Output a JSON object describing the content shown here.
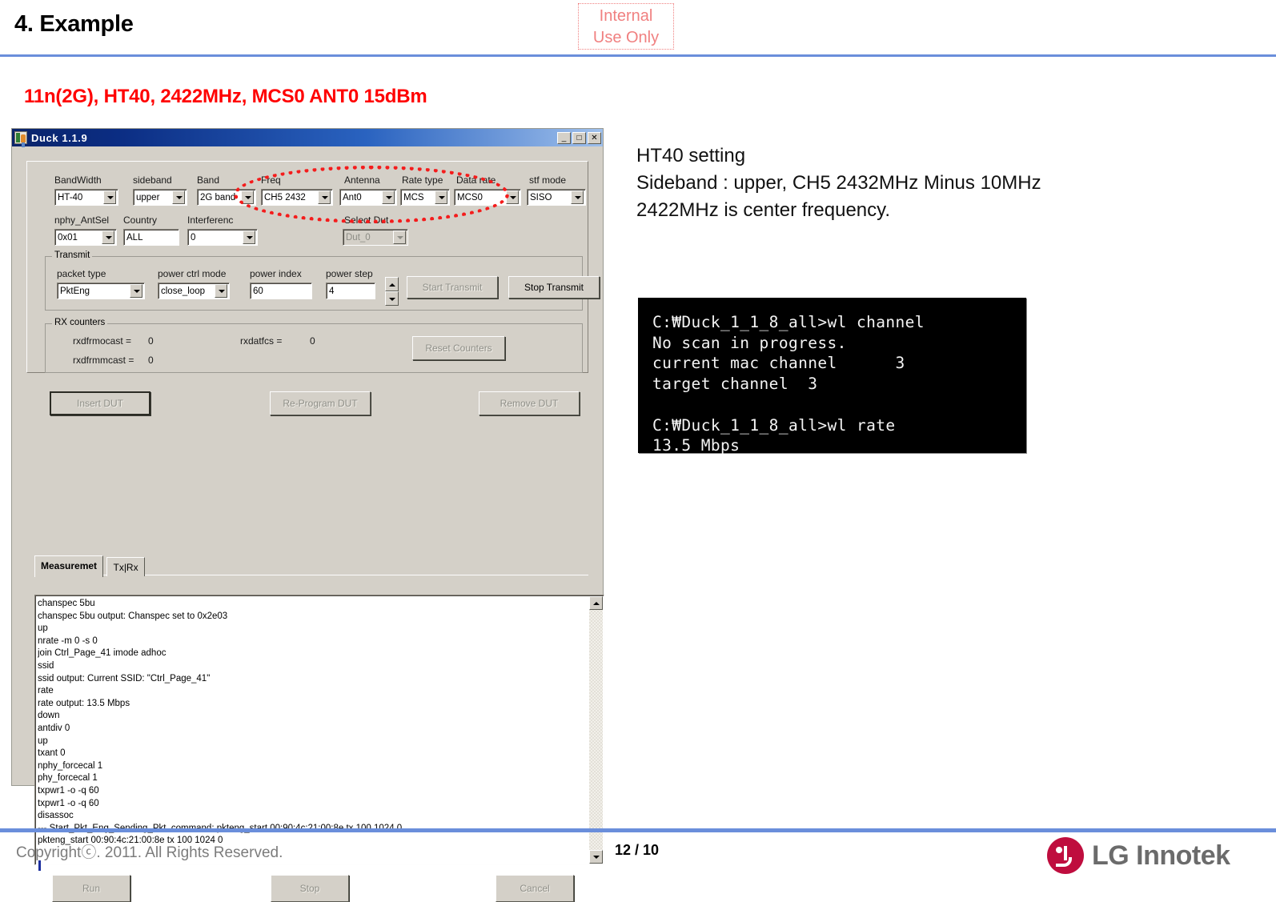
{
  "slide": {
    "title": "4. Example",
    "stamp_line1": "Internal",
    "stamp_line2": "Use Only",
    "caption": "11n(2G), HT40, 2422MHz, MCS0 ANT0 15dBm",
    "accent_color": "#6a8edb",
    "caption_color": "#ff0000",
    "stamp_color": "#f08080"
  },
  "notes": {
    "line1": "HT40 setting",
    "line2": "Sideband : upper, CH5 2432MHz Minus 10MHz",
    "line3": "2422MHz is center frequency."
  },
  "console": {
    "lines": [
      "C:₩Duck_1_1_8_all>wl channel",
      "No scan in progress.",
      "current mac channel      3",
      "target channel  3",
      "",
      "C:₩Duck_1_1_8_all>wl rate",
      "13.5 Mbps"
    ]
  },
  "duck_window": {
    "title": "Duck 1.1.9",
    "titlebar_icon": "app-icon",
    "minimize_glyph": "_",
    "maximize_glyph": "□",
    "close_glyph": "✕",
    "fields": {
      "bandwidth": {
        "label": "BandWidth",
        "value": "HT-40"
      },
      "sideband": {
        "label": "sideband",
        "value": "upper"
      },
      "band": {
        "label": "Band",
        "value": "2G band"
      },
      "freq": {
        "label": "Freq",
        "value": "CH5 2432"
      },
      "antenna": {
        "label": "Antenna",
        "value": "Ant0"
      },
      "rate_type": {
        "label": "Rate type",
        "value": "MCS"
      },
      "data_rate": {
        "label": "Data rate",
        "value": "MCS0"
      },
      "stf_mode": {
        "label": "stf mode",
        "value": "SISO"
      },
      "nphy_antsel": {
        "label": "nphy_AntSel",
        "value": "0x01"
      },
      "country": {
        "label": "Country",
        "value": "ALL"
      },
      "interferenc": {
        "label": "Interferenc",
        "value": "0"
      },
      "select_dut": {
        "label": "Select Dut",
        "value": "Dut_0"
      }
    },
    "transmit": {
      "group_label": "Transmit",
      "packet_type": {
        "label": "packet type",
        "value": "PktEng"
      },
      "power_ctrl_mode": {
        "label": "power ctrl mode",
        "value": "close_loop"
      },
      "power_index": {
        "label": "power index",
        "value": "60"
      },
      "power_step": {
        "label": "power step",
        "value": "4"
      },
      "start_button": "Start Transmit",
      "stop_button": "Stop Transmit"
    },
    "rx_counters": {
      "group_label": "RX counters",
      "rows": [
        {
          "label": "rxdfrmocast =",
          "value": "0"
        },
        {
          "label": "rxdatfcs =",
          "value": "0"
        },
        {
          "label": "rxdfrmmcast =",
          "value": "0"
        }
      ],
      "reset_button": "Reset Counters"
    },
    "dut_buttons": {
      "insert": "Insert DUT",
      "reprogram": "Re-Program DUT",
      "remove": "Remove DUT"
    },
    "tabs": [
      {
        "label": "Measuremet",
        "selected": true
      },
      {
        "label": "Tx|Rx",
        "selected": false
      }
    ],
    "log_lines": [
      "chanspec 5bu",
      "chanspec 5bu output: Chanspec set to 0x2e03",
      "up",
      "nrate -m 0 -s 0",
      "join Ctrl_Page_41 imode adhoc",
      "ssid",
      "ssid output: Current SSID: \"Ctrl_Page_41\"",
      "rate",
      "rate output: 13.5 Mbps",
      "down",
      "antdiv 0",
      "up",
      "txant 0",
      "nphy_forcecal 1",
      "phy_forcecal 1",
      "txpwr1 -o -q 60",
      "txpwr1 -o -q 60",
      "disassoc",
      "  --- Start_Pkt_Eng_Sending_Pkt, command: pkteng_start 00:90:4c:21:00:8e tx 100 1024 0",
      "pkteng_start 00:90:4c:21:00:8e tx 100 1024 0"
    ],
    "bottom_buttons": {
      "run": "Run",
      "stop": "Stop",
      "cancel": "Cancel"
    },
    "scrollbar": {
      "up_icon": "scroll-up-icon",
      "down_icon": "scroll-down-icon"
    }
  },
  "footer": {
    "copyright": "Copyrightⓒ. 2011. All Rights Reserved.",
    "page": "12 / 10",
    "brand": "LG Innotek",
    "brand_color": "#bf0d3e"
  }
}
